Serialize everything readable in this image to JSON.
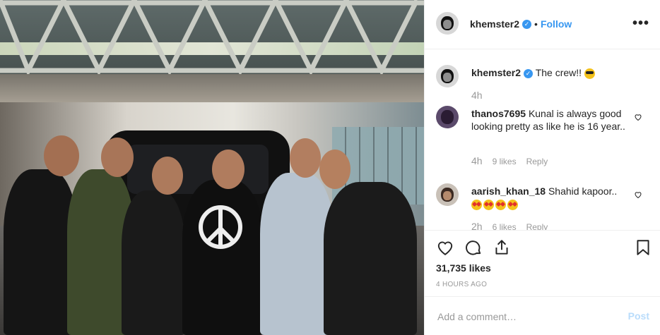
{
  "post": {
    "username": "khemster2",
    "follow_label": "Follow",
    "separator": "•",
    "more_icon": "more-dots-icon",
    "caption_text": "The crew!!",
    "caption_time": "4h",
    "likes": "31,735 likes",
    "date": "4 HOURS AGO"
  },
  "comments": [
    {
      "username": "thanos7695",
      "text": "Kunal is always good looking pretty as like he is 16 year..",
      "time": "4h",
      "likes": "9 likes",
      "reply": "Reply"
    },
    {
      "username": "aarish_khan_18",
      "text": "Shahid kapoor..",
      "time": "2h",
      "likes": "6 likes",
      "reply": "Reply"
    }
  ],
  "add_comment": {
    "placeholder": "Add a comment…",
    "post_label": "Post"
  },
  "photo": {
    "description_icon": "group-photo"
  },
  "colors": {
    "link": "#3897f0",
    "muted": "#999999",
    "text": "#262626",
    "post_disabled": "#b9dcfb"
  }
}
